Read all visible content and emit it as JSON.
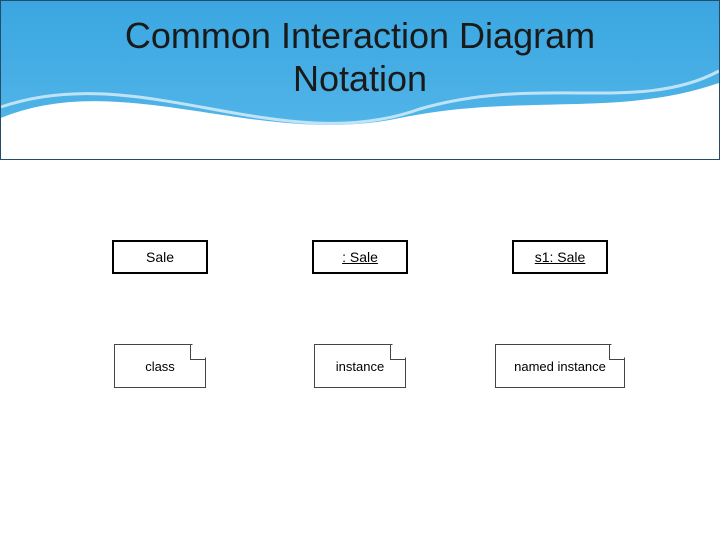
{
  "title": "Common Interaction Diagram Notation",
  "items": [
    {
      "box_label": "Sale",
      "underline": false,
      "note_label": "class"
    },
    {
      "box_label": ": Sale",
      "underline": true,
      "note_label": "instance"
    },
    {
      "box_label": "s1: Sale",
      "underline": true,
      "note_label": "named instance"
    }
  ]
}
